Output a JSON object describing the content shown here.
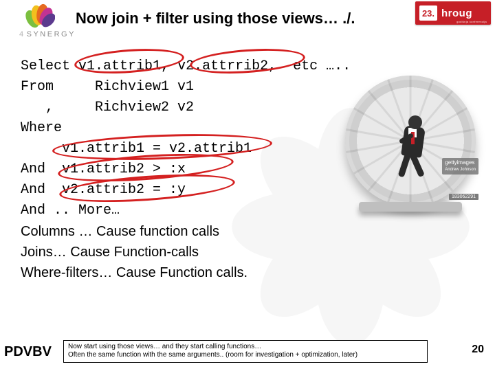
{
  "header": {
    "title": "Now join + filter using those views… ./.",
    "synergy_brand_prefix": "4",
    "synergy_brand": "SYNERGY",
    "badge_num": "23.",
    "badge_text": "hroug",
    "badge_sub": "godišnja konferencija"
  },
  "sql": {
    "l1_select": "Select ",
    "l1_c1": "v1.attrib1",
    "l1_sep": ", ",
    "l1_c2": "v2.attrrib2",
    "l1_tail": ",  etc …..",
    "l2": "From     Richview1 v1",
    "l3": "   ,     Richview2 v2",
    "l4": "Where",
    "l5_pre": "     ",
    "l5_expr": "v1.attrib1 = v2.attrib1",
    "l6_pre": "And  ",
    "l6_expr": "v1.attrib2 > :x",
    "l7_pre": "And  ",
    "l7_expr": "v2.attrib2 = :y",
    "l8": "And .. More…",
    "n1": "Columns … Cause function calls",
    "n2": "Joins… Cause Function-calls",
    "n3": "Where-filters… Cause Function calls."
  },
  "stock": {
    "brand_line1": "gettyimages",
    "brand_line2": "Andrew Johnson",
    "id": "183062291"
  },
  "footer": {
    "brand": "PDVBV",
    "box_l1": "Now start using those views… and they start calling functions…",
    "box_l2": "Often the same function with the same arguments..  (room for investigation + optimization, later)",
    "page": "20"
  }
}
